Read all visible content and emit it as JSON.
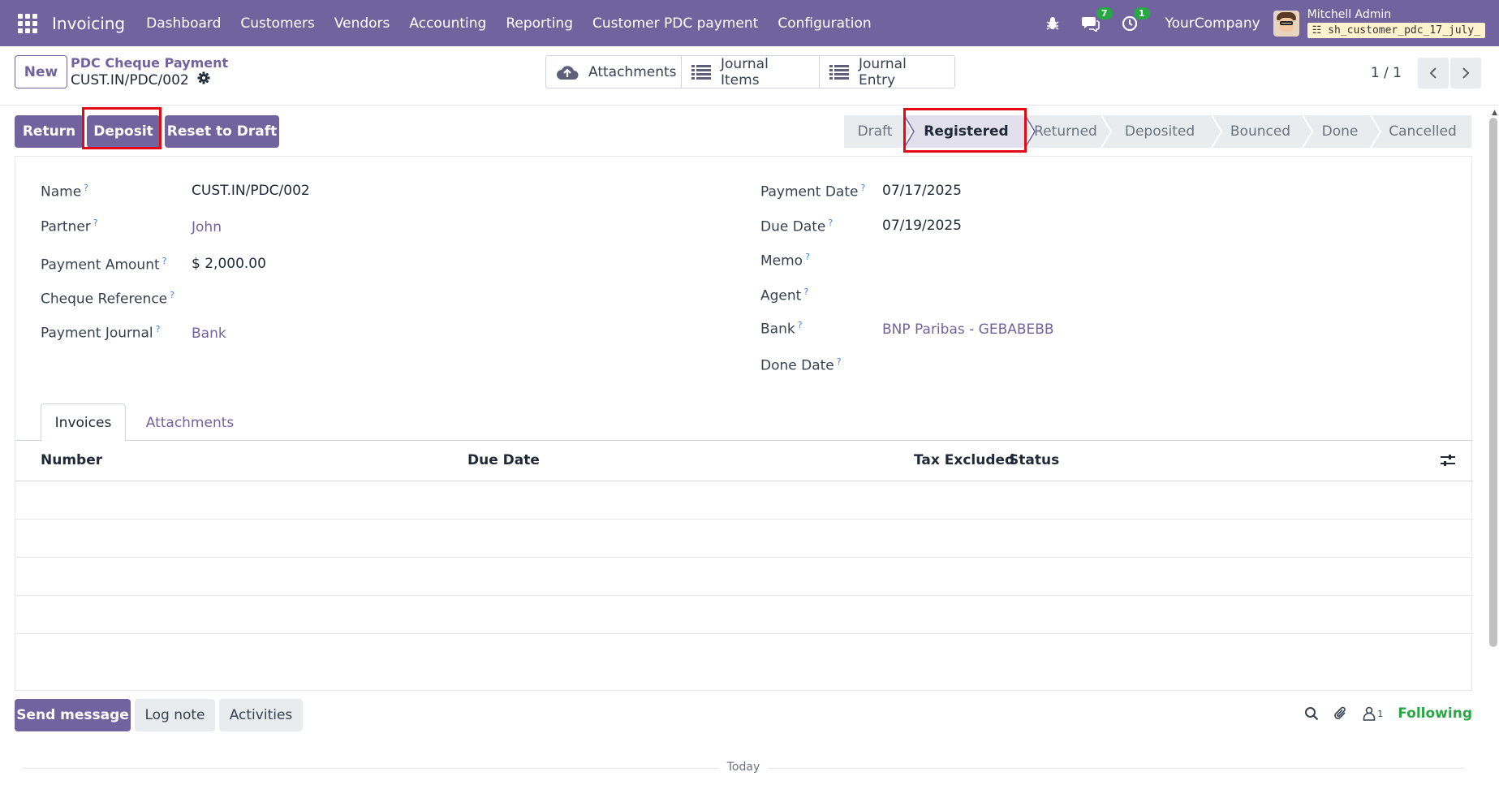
{
  "navbar": {
    "brand": "Invoicing",
    "menu": [
      "Dashboard",
      "Customers",
      "Vendors",
      "Accounting",
      "Reporting",
      "Customer PDC payment",
      "Configuration"
    ],
    "messages_badge": "7",
    "activities_badge": "1",
    "company": "YourCompany",
    "user_name": "Mitchell Admin",
    "db_name": "sh_customer_pdc_17_july_"
  },
  "control": {
    "new_label": "New",
    "breadcrumb_parent": "PDC Cheque Payment",
    "breadcrumb_current": "CUST.IN/PDC/002",
    "smart_buttons": [
      "Attachments",
      "Journal Items",
      "Journal Entry"
    ],
    "pager": "1 / 1"
  },
  "actions": {
    "return_label": "Return",
    "deposit_label": "Deposit",
    "reset_label": "Reset to Draft"
  },
  "stages": {
    "items": [
      "Draft",
      "Registered",
      "Returned",
      "Deposited",
      "Bounced",
      "Done",
      "Cancelled"
    ],
    "active": "Registered"
  },
  "form": {
    "left": [
      {
        "label": "Name",
        "value": "CUST.IN/PDC/002",
        "link": false
      },
      {
        "label": "Partner",
        "value": "John",
        "link": true
      },
      {
        "label": "Payment Amount",
        "value": "$ 2,000.00",
        "link": false
      },
      {
        "label": "Cheque Reference",
        "value": "",
        "link": false
      },
      {
        "label": "Payment Journal",
        "value": "Bank",
        "link": true
      }
    ],
    "right": [
      {
        "label": "Payment Date",
        "value": "07/17/2025",
        "link": false
      },
      {
        "label": "Due Date",
        "value": "07/19/2025",
        "link": false
      },
      {
        "label": "Memo",
        "value": "",
        "link": false
      },
      {
        "label": "Agent",
        "value": "",
        "link": false
      },
      {
        "label": "Bank",
        "value": "BNP Paribas - GEBABEBB",
        "link": true
      },
      {
        "label": "Done Date",
        "value": "",
        "link": false
      }
    ],
    "help_mark": "?"
  },
  "tabs": [
    "Invoices",
    "Attachments"
  ],
  "table": {
    "columns": [
      "Number",
      "Due Date",
      "Tax Excluded",
      "Status"
    ]
  },
  "chatter": {
    "send_message": "Send message",
    "log_note": "Log note",
    "activities": "Activities",
    "followers_count": "1",
    "following": "Following",
    "today": "Today"
  },
  "colors": {
    "brand": "#71639e",
    "highlight": "#e50914",
    "following": "#28a745"
  }
}
